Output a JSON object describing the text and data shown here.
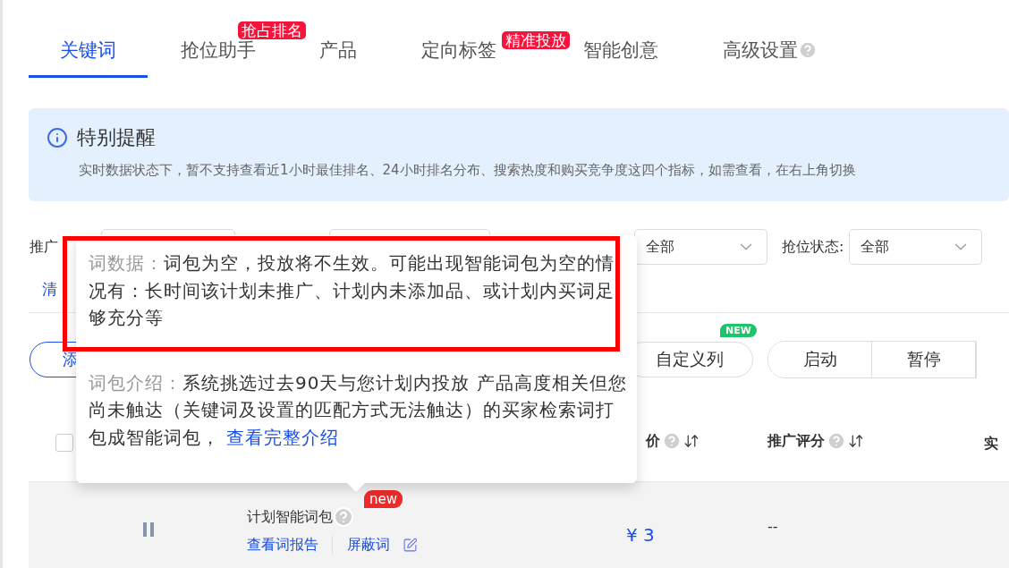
{
  "tabs": [
    {
      "label": "关键词",
      "selected": true
    },
    {
      "label": "抢位助手",
      "selected": false,
      "badge": "抢占排名"
    },
    {
      "label": "产品",
      "selected": false
    },
    {
      "label": "定向标签",
      "selected": false,
      "badge": "精准投放"
    },
    {
      "label": "智能创意",
      "selected": false
    },
    {
      "label": "高级设置",
      "selected": false,
      "help": true
    }
  ],
  "alert": {
    "title": "特别提醒",
    "text": "实时数据状态下，暂不支持查看近1小时最佳排名、24小时排名分布、搜索热度和购买竞争度这四个指标，如需查看，在右上角切换"
  },
  "filter_row": [
    {
      "kind": "label",
      "text": "推广"
    },
    {
      "kind": "select"
    },
    {
      "kind": "select"
    },
    {
      "kind": "select",
      "value": "全部"
    },
    {
      "kind": "label",
      "text": "抢位状态:"
    },
    {
      "kind": "select",
      "value": "全部"
    }
  ],
  "clear_link": "清",
  "toolbar": {
    "add_button": "添",
    "custom_columns": {
      "label": "自定义列",
      "badge": "NEW"
    },
    "group": [
      "启动",
      "暂停"
    ]
  },
  "table": {
    "select_all": {
      "checked": false
    },
    "columns": [
      {
        "label": "价",
        "help": true,
        "sortable": true
      },
      {
        "label": "推广评分",
        "help": true,
        "sortable": true
      },
      {
        "label": "实"
      }
    ],
    "rows": [
      {
        "paused": true,
        "name": "计划智能词包",
        "badge": "new",
        "links": [
          "查看词报告",
          "屏蔽词"
        ],
        "bid": "¥ 3",
        "score": "--"
      }
    ]
  },
  "popover": {
    "sections": [
      {
        "label": "词数据：",
        "text": "词包为空，投放将不生效。可能出现智能词包为空的情况有：长时间该计划未推广、计划内未添加品、或计划内买词足够充分等",
        "highlighted": true
      },
      {
        "label": "词包介绍：",
        "text": "系统挑选过去90天与您计划内投放 产品高度相关但您尚未触达（关键词及设置的匹配方式无法触达）的买家检索词打包成智能词包， ",
        "link": "查看完整介绍",
        "highlighted": false
      }
    ]
  }
}
